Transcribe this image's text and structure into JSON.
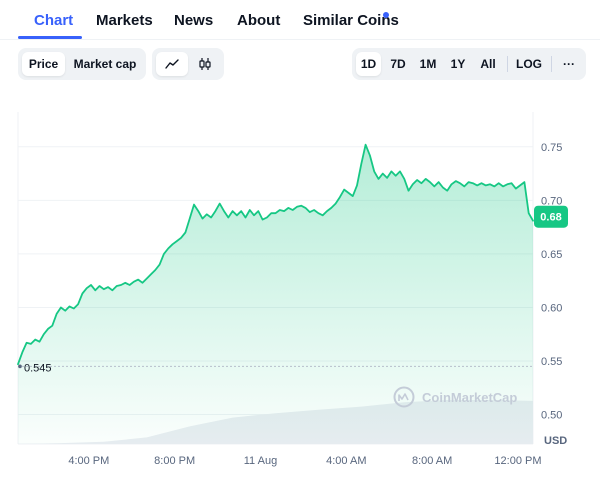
{
  "tabs": [
    {
      "label": "Chart",
      "active": true
    },
    {
      "label": "Markets"
    },
    {
      "label": "News"
    },
    {
      "label": "About"
    },
    {
      "label": "Similar Coins",
      "dot": true
    }
  ],
  "toolbar": {
    "metric_options": [
      "Price",
      "Market cap"
    ],
    "selected_metric": "Price",
    "chart_styles": [
      {
        "icon": "line-chart-icon",
        "active": true
      },
      {
        "icon": "candlestick-icon",
        "active": false
      }
    ],
    "ranges": [
      "1D",
      "7D",
      "1M",
      "1Y",
      "All"
    ],
    "selected_range": "1D",
    "log_label": "LOG",
    "more_label": "···"
  },
  "watermark": "CoinMarketCap",
  "colors": {
    "accent": "#3861fb",
    "up": "#16c784",
    "volume": "#eaedf2"
  },
  "chart_data": {
    "type": "area",
    "currency": "USD",
    "current_price_label": "0.68",
    "reference_label": "0.545",
    "reference_value": 0.545,
    "y_ticks": [
      0.75,
      0.7,
      0.65,
      0.6,
      0.55,
      0.5
    ],
    "y_tick_labels": [
      "0.75",
      "0.70",
      "0.65",
      "0.60",
      "0.55",
      "0.50"
    ],
    "ylim": [
      0.4725,
      0.7825
    ],
    "x_ticks": [
      {
        "t": 3.3,
        "label": "4:00 PM"
      },
      {
        "t": 7.3,
        "label": "8:00 PM"
      },
      {
        "t": 11.3,
        "label": "11 Aug"
      },
      {
        "t": 15.3,
        "label": "4:00 AM"
      },
      {
        "t": 19.3,
        "label": "8:00 AM"
      },
      {
        "t": 23.3,
        "label": "12:00 PM"
      }
    ],
    "x_range": [
      0,
      24
    ],
    "series": [
      {
        "points": [
          [
            0.0,
            0.547
          ],
          [
            0.2,
            0.558
          ],
          [
            0.4,
            0.567
          ],
          [
            0.6,
            0.566
          ],
          [
            0.8,
            0.57
          ],
          [
            1.0,
            0.568
          ],
          [
            1.2,
            0.575
          ],
          [
            1.4,
            0.58
          ],
          [
            1.6,
            0.583
          ],
          [
            1.8,
            0.594
          ],
          [
            2.0,
            0.6
          ],
          [
            2.2,
            0.597
          ],
          [
            2.4,
            0.601
          ],
          [
            2.6,
            0.599
          ],
          [
            2.8,
            0.603
          ],
          [
            3.0,
            0.613
          ],
          [
            3.2,
            0.618
          ],
          [
            3.4,
            0.621
          ],
          [
            3.6,
            0.616
          ],
          [
            3.8,
            0.62
          ],
          [
            4.0,
            0.617
          ],
          [
            4.2,
            0.619
          ],
          [
            4.4,
            0.616
          ],
          [
            4.6,
            0.62
          ],
          [
            4.8,
            0.621
          ],
          [
            5.0,
            0.623
          ],
          [
            5.2,
            0.621
          ],
          [
            5.4,
            0.624
          ],
          [
            5.6,
            0.626
          ],
          [
            5.8,
            0.623
          ],
          [
            6.0,
            0.627
          ],
          [
            6.2,
            0.631
          ],
          [
            6.4,
            0.635
          ],
          [
            6.6,
            0.64
          ],
          [
            6.8,
            0.65
          ],
          [
            7.0,
            0.655
          ],
          [
            7.2,
            0.659
          ],
          [
            7.4,
            0.662
          ],
          [
            7.6,
            0.665
          ],
          [
            7.8,
            0.67
          ],
          [
            8.0,
            0.683
          ],
          [
            8.2,
            0.696
          ],
          [
            8.4,
            0.69
          ],
          [
            8.6,
            0.683
          ],
          [
            8.8,
            0.687
          ],
          [
            9.0,
            0.684
          ],
          [
            9.2,
            0.69
          ],
          [
            9.4,
            0.697
          ],
          [
            9.6,
            0.69
          ],
          [
            9.8,
            0.684
          ],
          [
            10.0,
            0.69
          ],
          [
            10.2,
            0.686
          ],
          [
            10.4,
            0.69
          ],
          [
            10.6,
            0.684
          ],
          [
            10.8,
            0.691
          ],
          [
            11.0,
            0.686
          ],
          [
            11.2,
            0.69
          ],
          [
            11.4,
            0.682
          ],
          [
            11.6,
            0.684
          ],
          [
            11.8,
            0.688
          ],
          [
            12.0,
            0.688
          ],
          [
            12.2,
            0.691
          ],
          [
            12.4,
            0.69
          ],
          [
            12.6,
            0.693
          ],
          [
            12.8,
            0.691
          ],
          [
            13.0,
            0.694
          ],
          [
            13.2,
            0.695
          ],
          [
            13.4,
            0.693
          ],
          [
            13.6,
            0.689
          ],
          [
            13.8,
            0.691
          ],
          [
            14.0,
            0.688
          ],
          [
            14.2,
            0.686
          ],
          [
            14.4,
            0.69
          ],
          [
            14.6,
            0.693
          ],
          [
            14.8,
            0.697
          ],
          [
            15.0,
            0.703
          ],
          [
            15.2,
            0.71
          ],
          [
            15.4,
            0.707
          ],
          [
            15.6,
            0.704
          ],
          [
            15.8,
            0.714
          ],
          [
            16.0,
            0.734
          ],
          [
            16.2,
            0.752
          ],
          [
            16.4,
            0.742
          ],
          [
            16.6,
            0.727
          ],
          [
            16.8,
            0.72
          ],
          [
            17.0,
            0.725
          ],
          [
            17.2,
            0.721
          ],
          [
            17.4,
            0.727
          ],
          [
            17.6,
            0.723
          ],
          [
            17.8,
            0.727
          ],
          [
            18.0,
            0.72
          ],
          [
            18.2,
            0.709
          ],
          [
            18.4,
            0.715
          ],
          [
            18.6,
            0.719
          ],
          [
            18.8,
            0.716
          ],
          [
            19.0,
            0.72
          ],
          [
            19.2,
            0.717
          ],
          [
            19.4,
            0.713
          ],
          [
            19.6,
            0.717
          ],
          [
            19.8,
            0.712
          ],
          [
            20.0,
            0.709
          ],
          [
            20.2,
            0.715
          ],
          [
            20.4,
            0.718
          ],
          [
            20.6,
            0.716
          ],
          [
            20.8,
            0.713
          ],
          [
            21.0,
            0.717
          ],
          [
            21.2,
            0.716
          ],
          [
            21.4,
            0.714
          ],
          [
            21.6,
            0.716
          ],
          [
            21.8,
            0.714
          ],
          [
            22.0,
            0.715
          ],
          [
            22.2,
            0.713
          ],
          [
            22.4,
            0.716
          ],
          [
            22.6,
            0.713
          ],
          [
            22.8,
            0.715
          ],
          [
            23.0,
            0.716
          ],
          [
            23.2,
            0.711
          ],
          [
            23.4,
            0.714
          ],
          [
            23.6,
            0.717
          ],
          [
            23.8,
            0.688
          ],
          [
            24.0,
            0.681
          ]
        ]
      }
    ],
    "volume": [
      [
        0.0,
        0.0
      ],
      [
        2.0,
        0.02
      ],
      [
        4.0,
        0.05
      ],
      [
        6.0,
        0.15
      ],
      [
        8.0,
        0.4
      ],
      [
        10.0,
        0.6
      ],
      [
        12.0,
        0.7
      ],
      [
        14.0,
        0.78
      ],
      [
        16.0,
        0.85
      ],
      [
        18.0,
        0.95
      ],
      [
        20.0,
        1.0
      ],
      [
        22.0,
        1.0
      ],
      [
        24.0,
        0.98
      ]
    ],
    "grid": true,
    "legend": "none"
  }
}
